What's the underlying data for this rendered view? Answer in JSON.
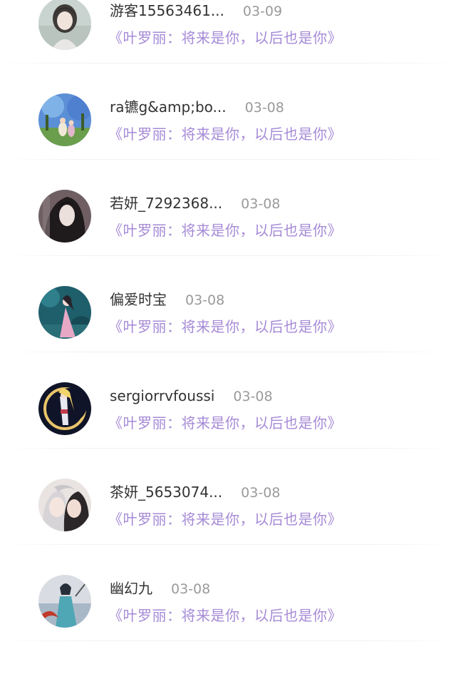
{
  "comments": [
    {
      "name": "游客15563461...",
      "date": "03-09",
      "work": "《叶罗丽：将来是你，以后也是你》",
      "avatar_icon": "avatar-girl-pale-icon"
    },
    {
      "name": "ra镳g&amp;bo...",
      "date": "03-08",
      "work": "《叶罗丽：将来是你，以后也是你》",
      "avatar_icon": "avatar-forest-scene-icon"
    },
    {
      "name": "若妍_7292368...",
      "date": "03-08",
      "work": "《叶罗丽：将来是你，以后也是你》",
      "avatar_icon": "avatar-dark-hair-girl-icon"
    },
    {
      "name": "偏爱时宝",
      "date": "03-08",
      "work": "《叶罗丽：将来是你，以后也是你》",
      "avatar_icon": "avatar-fairy-pink-dress-icon"
    },
    {
      "name": "sergiorrvfoussi",
      "date": "03-08",
      "work": "《叶罗丽：将来是你，以后也是你》",
      "avatar_icon": "avatar-sailor-moon-icon"
    },
    {
      "name": "茶妍_5653074...",
      "date": "03-08",
      "work": "《叶罗丽：将来是你，以后也是你》",
      "avatar_icon": "avatar-anime-couple-icon"
    },
    {
      "name": "幽幻九",
      "date": "03-08",
      "work": "《叶罗丽：将来是你，以后也是你》",
      "avatar_icon": "avatar-warrior-girl-icon"
    }
  ],
  "colors": {
    "name_text": "#333333",
    "date_text": "#9a9a9a",
    "work_link": "#a58ad6",
    "divider": "#f0f0f0"
  }
}
